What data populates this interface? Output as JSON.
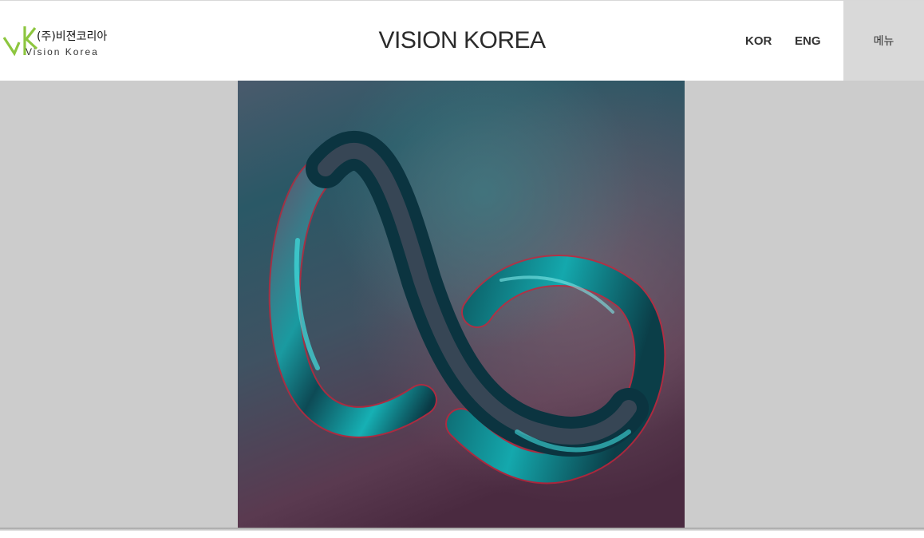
{
  "header": {
    "logo": {
      "korean": "(주)비젼코리아",
      "english": "Vision Korea",
      "mark_color": "#8dc63f"
    },
    "title": "VISION KOREA",
    "languages": [
      "KOR",
      "ENG"
    ],
    "menu_label": "메뉴"
  },
  "hero": {
    "image": "infinity-ribbon-3d-artwork",
    "colors": [
      "#1c8a8f",
      "#c8243a",
      "#4a3a52"
    ]
  },
  "colors": {
    "page_background": "#cccccc",
    "menu_button_background": "#d9d9d9"
  }
}
